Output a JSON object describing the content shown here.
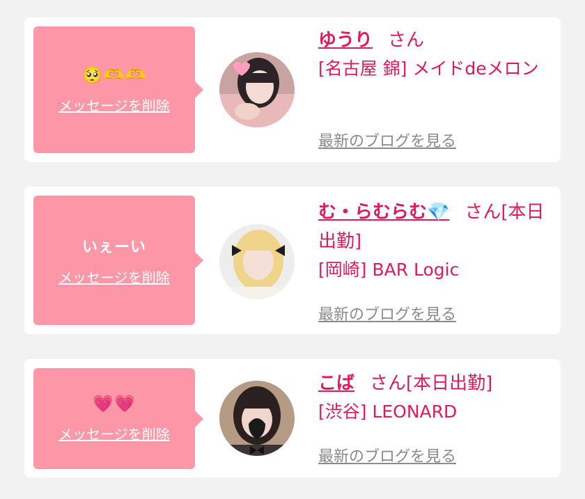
{
  "colors": {
    "background": "#f2f2f2",
    "card": "#ffffff",
    "bubble": "#fc97a8",
    "accent": "#e0195e",
    "muted": "#8a8a8a"
  },
  "messages": [
    {
      "message": "🥺🫶🫶",
      "delete_label": "メッセージを削除",
      "name": "ゆうり",
      "honorific": "さん",
      "shop": "[名古屋 錦] メイドdeメロン",
      "blog_label": "最新のブログを見る",
      "avatar_icon": "girl-photo-avatar"
    },
    {
      "message": "いぇーい",
      "delete_label": "メッセージを削除",
      "name": "む・らむらむ💎",
      "honorific": "さん[本日出勤]",
      "shop": "[岡崎] BAR Logic",
      "blog_label": "最新のブログを見る",
      "avatar_icon": "blonde-girl-avatar"
    },
    {
      "message": "💗💗",
      "delete_label": "メッセージを削除",
      "name": "こば",
      "honorific": "さん[本日出勤]",
      "shop": "[渋谷] LEONARD",
      "blog_label": "最新のブログを見る",
      "avatar_icon": "dark-hair-girl-avatar"
    }
  ]
}
